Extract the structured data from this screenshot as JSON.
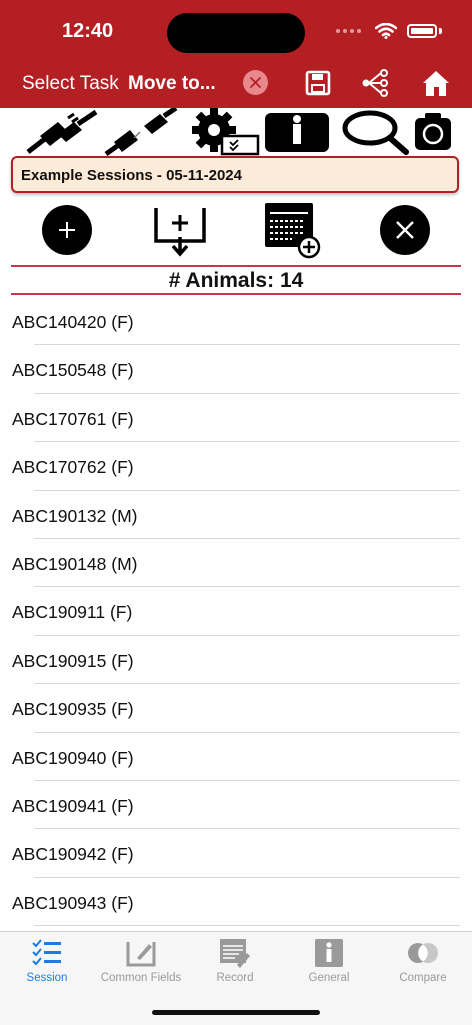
{
  "status": {
    "time": "12:40"
  },
  "nav": {
    "select_task": "Select Task",
    "task_value": "Move to...",
    "icons": [
      "clear-icon",
      "save-icon",
      "hierarchy-icon",
      "home-icon"
    ]
  },
  "toolbar": {
    "icons": [
      "connect-icon",
      "disconnect-icon",
      "settings-icon",
      "info-icon",
      "search-icon",
      "camera-icon"
    ]
  },
  "session": {
    "name": "Example Sessions - 05-11-2024"
  },
  "actions": {
    "icons": [
      "add-icon",
      "import-icon",
      "add-list-icon",
      "close-icon"
    ]
  },
  "count": {
    "label": "# Animals: 14"
  },
  "animals": [
    "ABC140420 (F)",
    "ABC150548 (F)",
    "ABC170761 (F)",
    "ABC170762 (F)",
    "ABC190132 (M)",
    "ABC190148 (M)",
    "ABC190911 (F)",
    "ABC190915 (F)",
    "ABC190935 (F)",
    "ABC190940 (F)",
    "ABC190941 (F)",
    "ABC190942 (F)",
    "ABC190943 (F)"
  ],
  "tabs": [
    {
      "label": "Session",
      "icon": "checklist-icon",
      "active": true
    },
    {
      "label": "Common Fields",
      "icon": "edit-icon",
      "active": false
    },
    {
      "label": "Record",
      "icon": "record-icon",
      "active": false
    },
    {
      "label": "General",
      "icon": "info-icon",
      "active": false
    },
    {
      "label": "Compare",
      "icon": "compare-icon",
      "active": false
    }
  ],
  "colors": {
    "header": "#b41f24",
    "session_bg": "#fcebd8",
    "tab_active": "#1c7ce0",
    "tab_inactive": "#9a9a9a"
  }
}
